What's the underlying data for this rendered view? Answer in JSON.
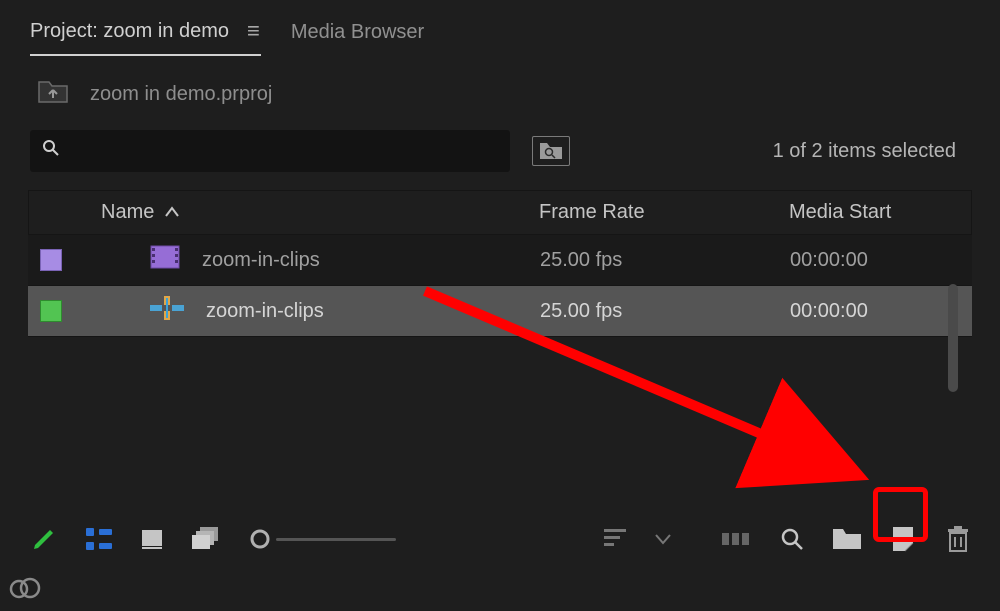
{
  "tabs": {
    "project_label": "Project: zoom in demo",
    "media_browser_label": "Media Browser"
  },
  "bin_path": {
    "project_file": "zoom in demo.prproj"
  },
  "search": {
    "placeholder": ""
  },
  "selection_status": "1 of 2 items selected",
  "columns": {
    "name": "Name",
    "frame_rate": "Frame Rate",
    "media_start": "Media Start"
  },
  "items": [
    {
      "name": "zoom-in-clips",
      "frame_rate": "25.00 fps",
      "media_start": "00:00:00",
      "swatch": "purple",
      "type": "bin"
    },
    {
      "name": "zoom-in-clips",
      "frame_rate": "25.00 fps",
      "media_start": "00:00:00",
      "swatch": "green",
      "type": "sequence"
    }
  ]
}
